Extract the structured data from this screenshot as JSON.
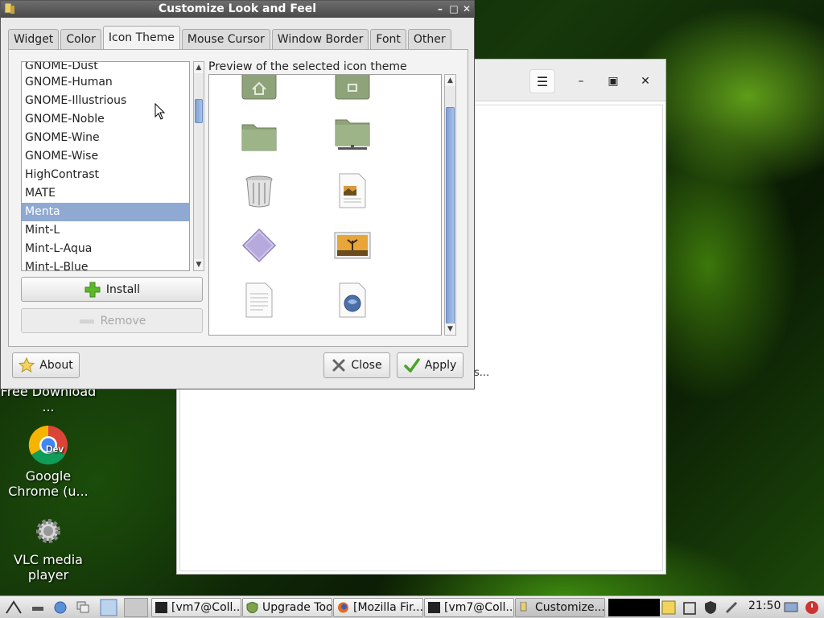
{
  "dialog": {
    "title": "Customize Look and Feel",
    "tabs": [
      "Widget",
      "Color",
      "Icon Theme",
      "Mouse Cursor",
      "Window Border",
      "Font",
      "Other"
    ],
    "active_tab": "Icon Theme",
    "theme_list": [
      "GNOME-Dust",
      "GNOME-Human",
      "GNOME-Illustrious",
      "GNOME-Noble",
      "GNOME-Wine",
      "GNOME-Wise",
      "HighContrast",
      "MATE",
      "Menta",
      "Mint-L",
      "Mint-L-Aqua",
      "Mint-L-Blue"
    ],
    "selected_theme": "Menta",
    "install_label": "Install",
    "remove_label": "Remove",
    "preview_label": "Preview of the selected icon theme",
    "about_label": "About",
    "close_label": "Close",
    "apply_label": "Apply"
  },
  "desktop": {
    "icons": [
      {
        "label": "Free Download ..."
      },
      {
        "label": "Google Chrome (u..."
      },
      {
        "label": "VLC media player"
      }
    ],
    "chrome_badge": "Dev"
  },
  "bg_window": {
    "ellipsis": "s..."
  },
  "taskbar": {
    "tasks": [
      "[vm7@Coll...",
      "Upgrade Tool",
      "[Mozilla Fir...",
      "[vm7@Coll...",
      "Customize..."
    ],
    "active_task": "Customize...",
    "clock": "21:50"
  },
  "colors": {
    "selection": "#8fa9d3",
    "titlebar": "#5a5a5a",
    "folder": "#8fa37a"
  }
}
